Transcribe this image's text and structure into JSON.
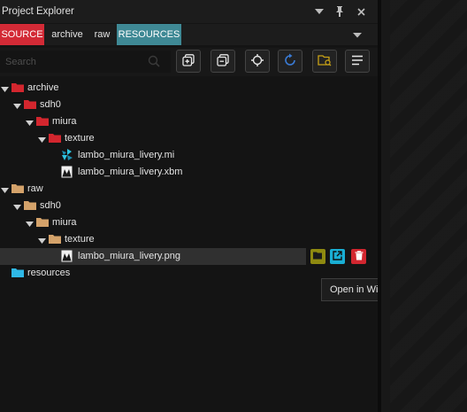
{
  "panel": {
    "title": "Project Explorer"
  },
  "tabs": [
    {
      "label": "SOURCE",
      "color": "#d32a36"
    },
    {
      "label": "archive"
    },
    {
      "label": "raw"
    },
    {
      "label": "RESOURCES",
      "color": "#3f8995"
    }
  ],
  "search": {
    "placeholder": "Search",
    "value": ""
  },
  "toolbar_icons": [
    "add-folder-icon",
    "copy-icon",
    "crosshair-icon",
    "refresh-icon",
    "open-folder-icon",
    "sort-lines-icon"
  ],
  "tree": {
    "archive": {
      "label": "archive",
      "sdh0": {
        "label": "sdh0",
        "miura": {
          "label": "miura",
          "texture": {
            "label": "texture",
            "files": [
              {
                "label": "lambo_miura_livery.mi",
                "icon": "material-icon"
              },
              {
                "label": "lambo_miura_livery.xbm",
                "icon": "image-file-icon"
              }
            ]
          }
        }
      }
    },
    "raw": {
      "label": "raw",
      "sdh0": {
        "label": "sdh0",
        "miura": {
          "label": "miura",
          "texture": {
            "label": "texture",
            "files": [
              {
                "label": "lambo_miura_livery.png",
                "icon": "image-file-icon",
                "selected": true
              }
            ]
          }
        }
      }
    },
    "resources": {
      "label": "resources"
    }
  },
  "row_actions": [
    "open-folder-icon",
    "open-external-icon",
    "trash-icon"
  ],
  "tooltip": "Open in Windows Explorer",
  "colors": {
    "archive_folder": "#d3262e",
    "raw_folder": "#d4a26a",
    "resources_folder": "#2fb8e6",
    "accent_blue": "#3a7bd5",
    "accent_yellow": "#c8a217"
  }
}
